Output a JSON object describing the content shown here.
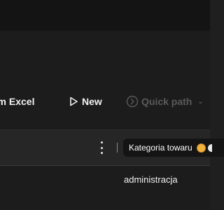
{
  "toolbar": {
    "excel_label": "om Excel",
    "new_label": "New",
    "quick_path_label": "Quick path",
    "new_icon": "play-outline-icon",
    "quick_path_icon": "chevron-circle-icon",
    "quick_path_dropdown_icon": "chevron-down-icon"
  },
  "grid": {
    "more_icon": "more-vertical-icon",
    "filter_chip_label": "Kategoria towaru",
    "rows": [
      {
        "value": "administracja"
      }
    ]
  },
  "colors": {
    "background": "#1f1f1f",
    "topbar": "#141414",
    "disabled_text": "#5a5a5a",
    "chip_background": "#141414"
  }
}
